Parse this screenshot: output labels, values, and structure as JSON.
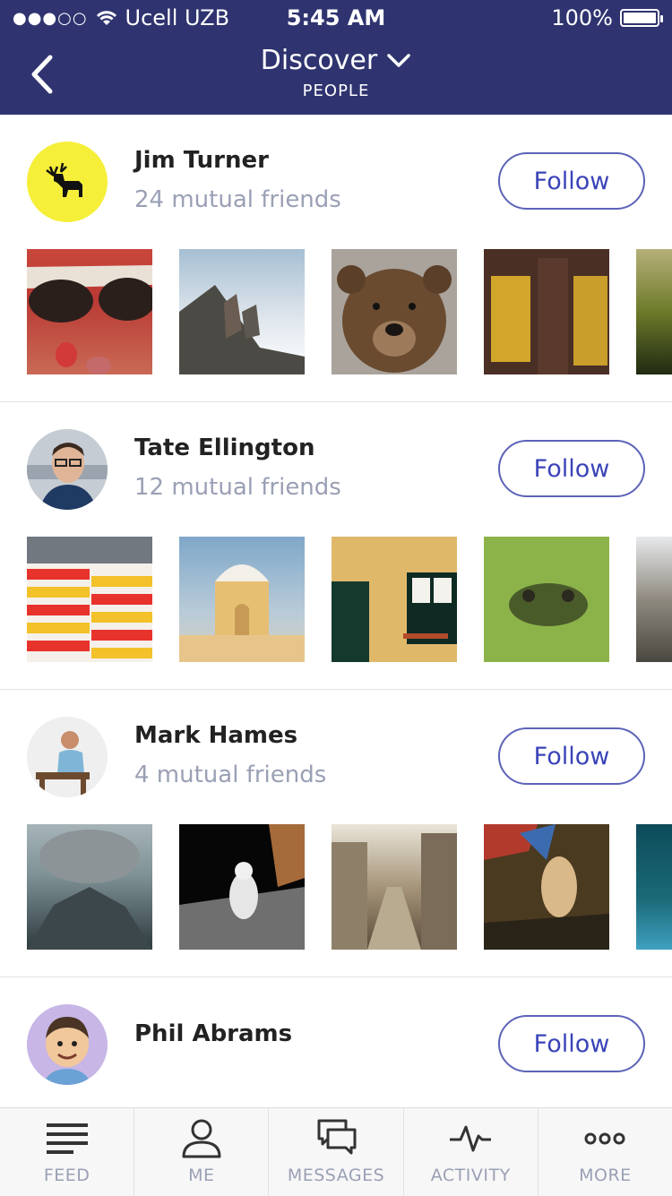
{
  "status_bar": {
    "carrier": "Ucell UZB",
    "time": "5:45 AM",
    "battery": "100%"
  },
  "header": {
    "title": "Discover",
    "subtitle": "PEOPLE",
    "background": "#2f3470"
  },
  "people": [
    {
      "name": "Jim Turner",
      "mutual": "24 mutual friends",
      "follow_label": "Follow"
    },
    {
      "name": "Tate Ellington",
      "mutual": "12 mutual friends",
      "follow_label": "Follow"
    },
    {
      "name": "Mark Hames",
      "mutual": "4 mutual friends",
      "follow_label": "Follow"
    },
    {
      "name": "Phil Abrams",
      "mutual": "",
      "follow_label": "Follow"
    }
  ],
  "tabs": [
    {
      "label": "FEED",
      "icon": "feed-icon"
    },
    {
      "label": "ME",
      "icon": "person-icon"
    },
    {
      "label": "MESSAGES",
      "icon": "chat-bubbles-icon"
    },
    {
      "label": "ACTIVITY",
      "icon": "pulse-icon"
    },
    {
      "label": "MORE",
      "icon": "more-dots-icon"
    }
  ],
  "colors": {
    "accent": "#3a44b8",
    "muted_text": "#9aa0b5"
  }
}
